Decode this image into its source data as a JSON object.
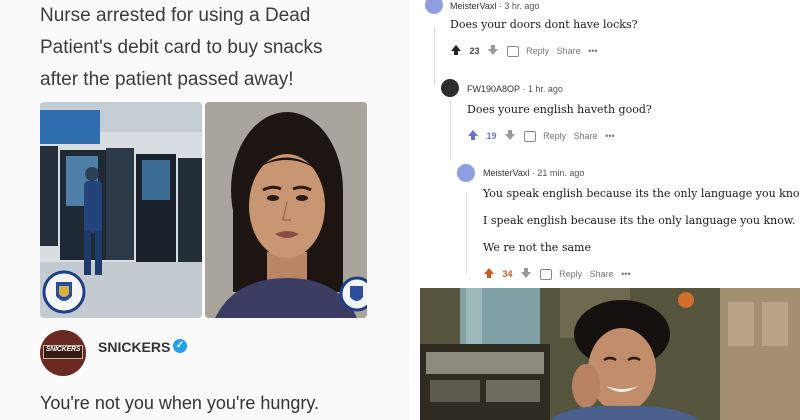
{
  "headline": [
    "Nurse arrested for using a Dead",
    "Patient's debit card to buy snacks",
    "after the patient passed away!"
  ],
  "brand": {
    "logo_text": "SNICKERS",
    "name": "SNICKERS",
    "tagline": "You're not you when you're hungry."
  },
  "comments": [
    {
      "user": "MeisterVaxl",
      "time": "3 hr. ago",
      "lines": [
        "Does your doors dont have locks?"
      ],
      "votes": "23",
      "reply": "Reply",
      "share": "Share",
      "more": "•••"
    },
    {
      "user": "FW190A8OP",
      "time": "1 hr. ago",
      "lines": [
        "Does youre english haveth good?"
      ],
      "votes": "19",
      "reply": "Reply",
      "share": "Share",
      "more": "•••"
    },
    {
      "user": "MeisterVaxl",
      "time": "21 min. ago",
      "lines": [
        "You speak english because its the only language you know.",
        "I speak english because its the only language you know.",
        "We re not the same"
      ],
      "votes": "34",
      "reply": "Reply",
      "share": "Share",
      "more": "•••"
    }
  ],
  "colors": {
    "upvote_orange": "#cc5a1e",
    "upvote_blue": "#6a73c8",
    "avatar_blue": "#8f9ee0",
    "avatar_dark": "#2d2d2d",
    "snickers_brown": "#6a2a22"
  },
  "icons": [
    "police-crest-icon",
    "verified-check-icon",
    "upvote-icon",
    "downvote-icon",
    "reply-icon",
    "avatar-icon"
  ]
}
